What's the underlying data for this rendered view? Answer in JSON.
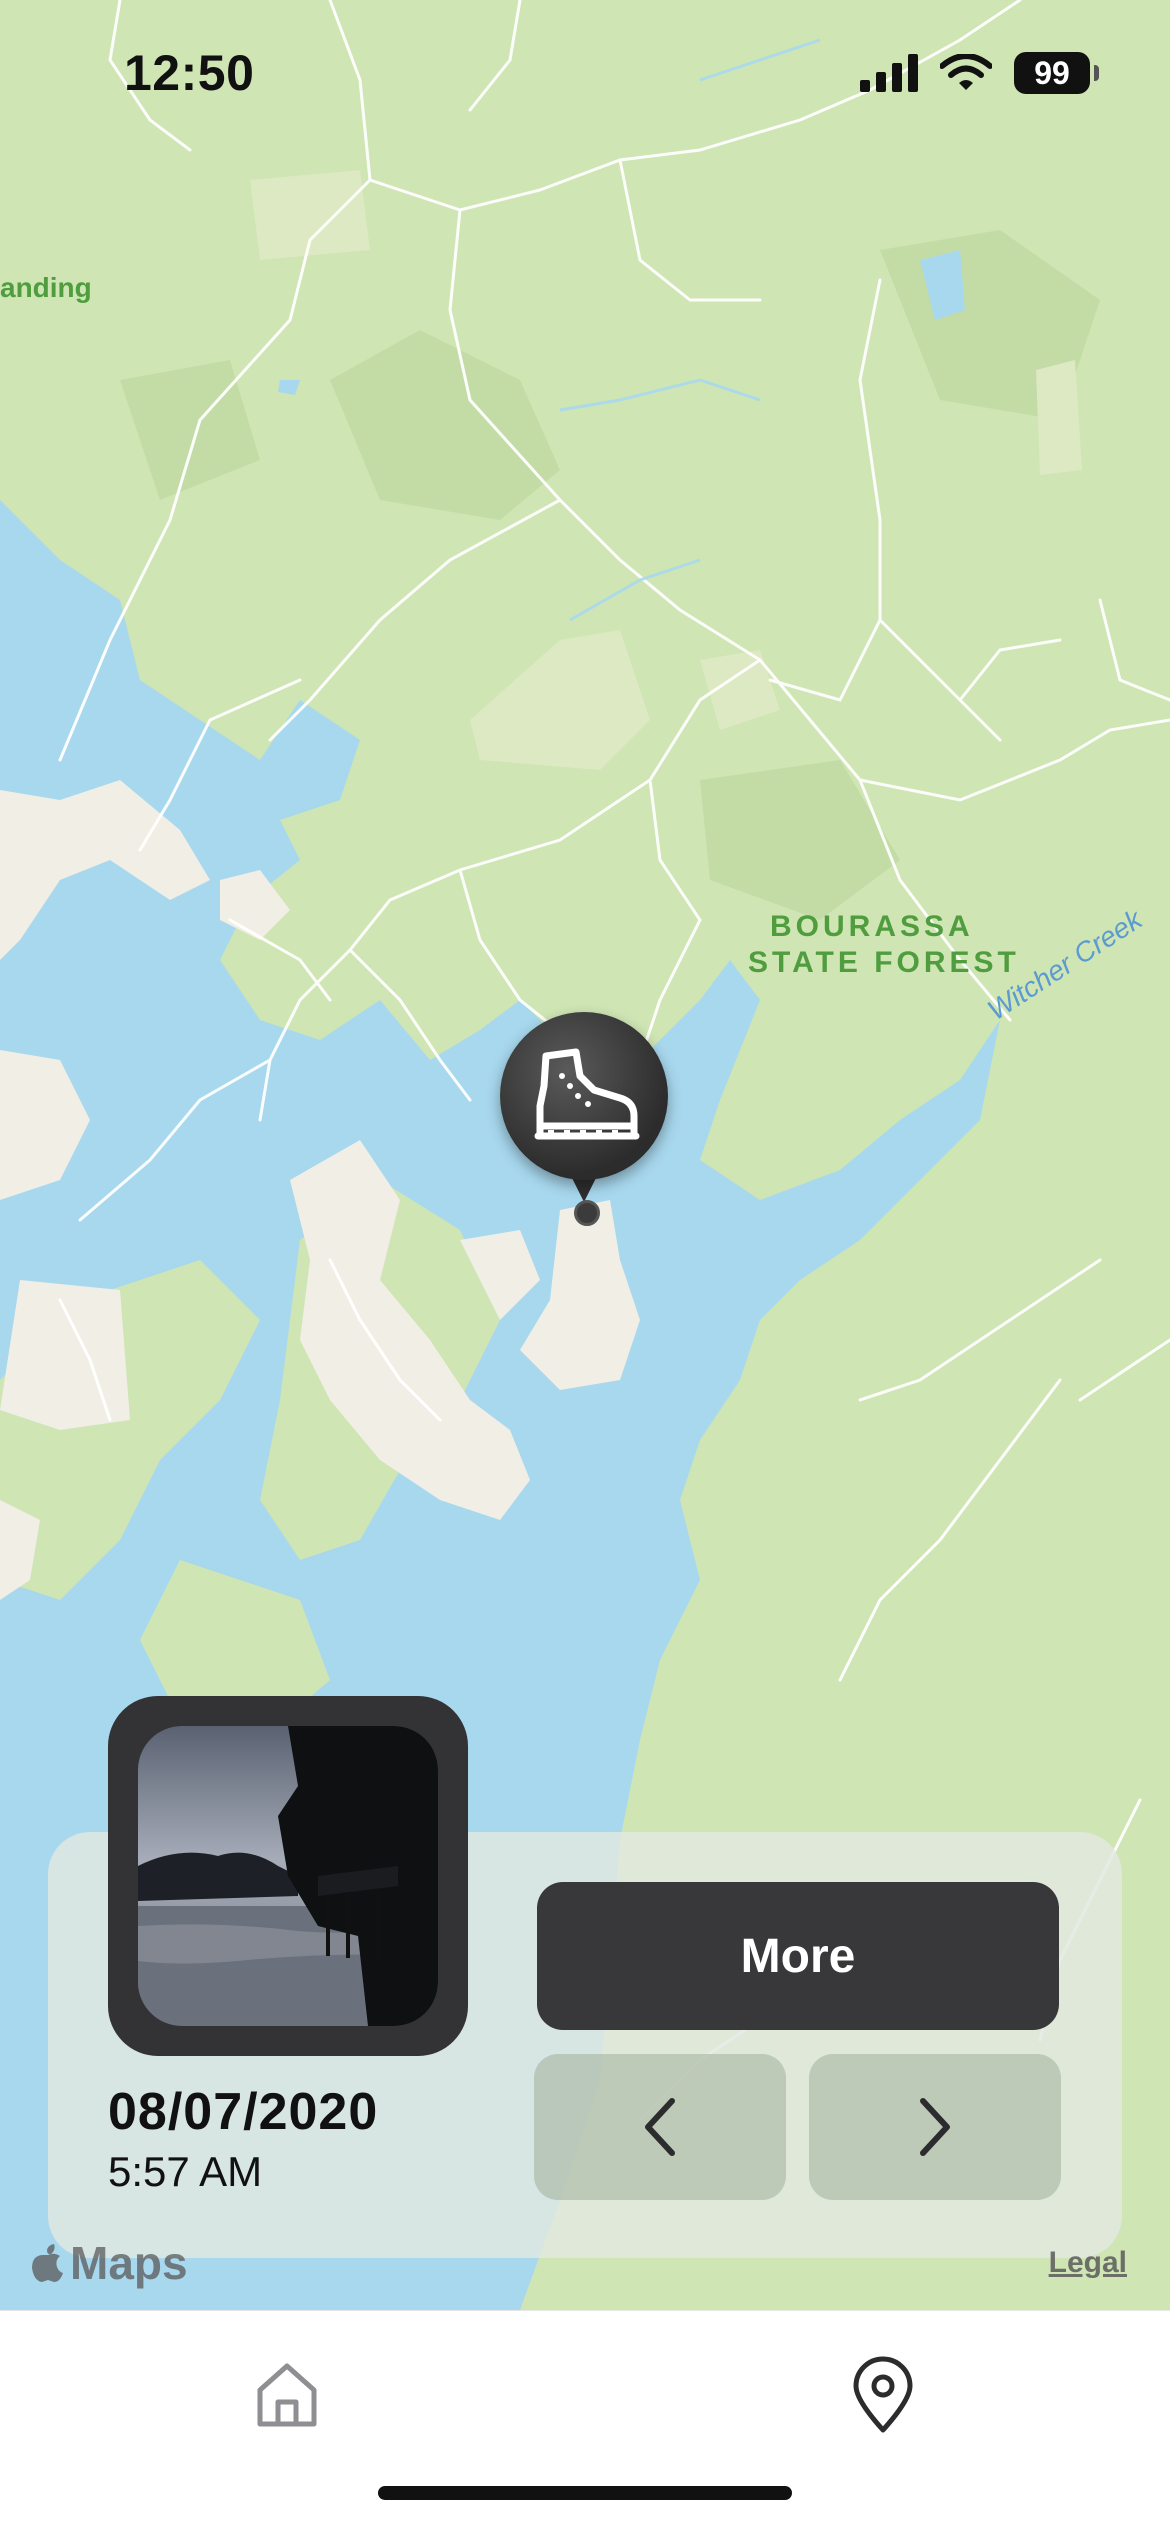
{
  "status_bar": {
    "time": "12:50",
    "battery_level": "99",
    "icons": [
      "cellular-signal-icon",
      "wifi-icon",
      "battery-icon"
    ]
  },
  "map": {
    "labels": {
      "landing_fragment": "anding",
      "forest_line1": "BOURASSA",
      "forest_line2": "STATE FOREST",
      "creek": "Witcher Creek"
    },
    "pin_icon": "hiking-boot-icon",
    "colors": {
      "land": "#cfe5b4",
      "water": "#a8d8ee",
      "developed": "#f1eee6",
      "pin": "#333333"
    }
  },
  "card": {
    "date": "08/07/2020",
    "time": "5:57 AM",
    "more_label": "More",
    "prev_icon": "chevron-left-icon",
    "next_icon": "chevron-right-icon"
  },
  "attribution": {
    "maps_label": "Maps",
    "legal_label": "Legal"
  },
  "tab_bar": {
    "items": [
      {
        "icon": "home-icon",
        "active": false
      },
      {
        "icon": "map-pin-icon",
        "active": true
      }
    ]
  }
}
